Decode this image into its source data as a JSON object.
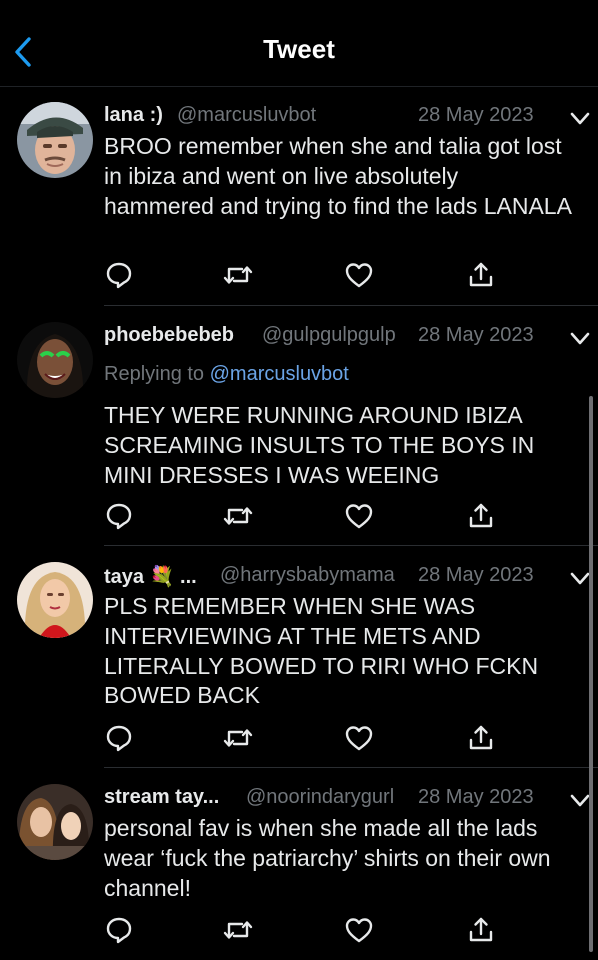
{
  "header": {
    "title": "Tweet",
    "back_icon": "chevron-left-icon"
  },
  "colors": {
    "background": "#000000",
    "text": "#e7e9ea",
    "secondary": "#71767b",
    "link": "#6ba4e6",
    "accent_back": "#1d9bf0"
  },
  "replies": [
    {
      "name": "lana :)",
      "handle": "@marcusluvbot",
      "date": "28 May 2023",
      "replying_prefix": "",
      "replying_to": "",
      "text": "BROO remember when she and talia got lost in ibiza and went on live absolutely hammered and trying to find the lads LANALA"
    },
    {
      "name": "phoebebebeb",
      "handle": "@gulpgulpgulp",
      "date": "28 May 2023",
      "replying_prefix": "Replying to ",
      "replying_to": "@marcusluvbot",
      "text": "THEY WERE RUNNING AROUND IBIZA SCREAMING INSULTS TO THE BOYS IN MINI DRESSES I WAS WEEING"
    },
    {
      "name": "taya 💐 ...",
      "handle": "@harrysbabymama",
      "date": "28 May 2023",
      "replying_prefix": "",
      "replying_to": "",
      "text": "PLS REMEMBER WHEN SHE WAS INTERVIEWING AT THE METS AND LITERALLY BOWED TO RIRI WHO FCKN BOWED BACK"
    },
    {
      "name": "stream tay...",
      "handle": "@noorindarygurl",
      "date": "28 May 2023",
      "replying_prefix": "",
      "replying_to": "",
      "text": "personal fav is when she made all the lads wear ‘fuck the patriarchy’ shirts on their own channel!"
    }
  ],
  "action_icons": [
    "reply-icon",
    "retweet-icon",
    "like-icon",
    "share-icon"
  ]
}
